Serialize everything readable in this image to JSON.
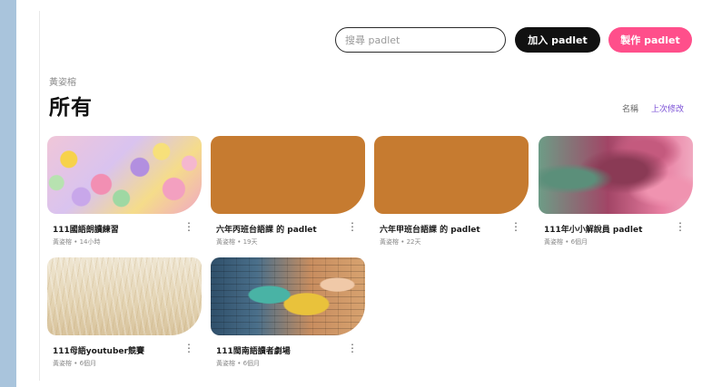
{
  "header": {
    "search_placeholder": "搜尋 padlet",
    "join_button": "加入 padlet",
    "make_button": "製作 padlet"
  },
  "section": {
    "owner": "黃姿榕",
    "title": "所有",
    "sort_by_name": "名稱",
    "sort_by_modified": "上次修改"
  },
  "padlets": [
    {
      "title": "111國語朗讀練習",
      "meta": "黃姿榕 • 14小時",
      "thumbnail": "candy-hearts-image"
    },
    {
      "title": "六年丙班台語課 的 padlet",
      "meta": "黃姿榕 • 19天",
      "thumbnail": "solid-orange"
    },
    {
      "title": "六年甲班台語課 的 padlet",
      "meta": "黃姿榕 • 22天",
      "thumbnail": "solid-orange"
    },
    {
      "title": "111年小小解說員 padlet",
      "meta": "黃姿榕 • 6個月",
      "thumbnail": "blurred-green-pink-image"
    },
    {
      "title": "111母語youtuber競賽",
      "meta": "黃姿榕 • 6個月",
      "thumbnail": "wheat-field-image"
    },
    {
      "title": "111閩南語讀者劇場",
      "meta": "黃姿榕 • 6個月",
      "thumbnail": "painted-brick-wall-image"
    }
  ],
  "icons": {
    "card_menu": "more-vertical-icon"
  },
  "colors": {
    "accent_pink": "#ff4f8b",
    "join_black": "#111111",
    "orange_thumb": "#c67b30",
    "sort_active": "#7a4fd6"
  }
}
